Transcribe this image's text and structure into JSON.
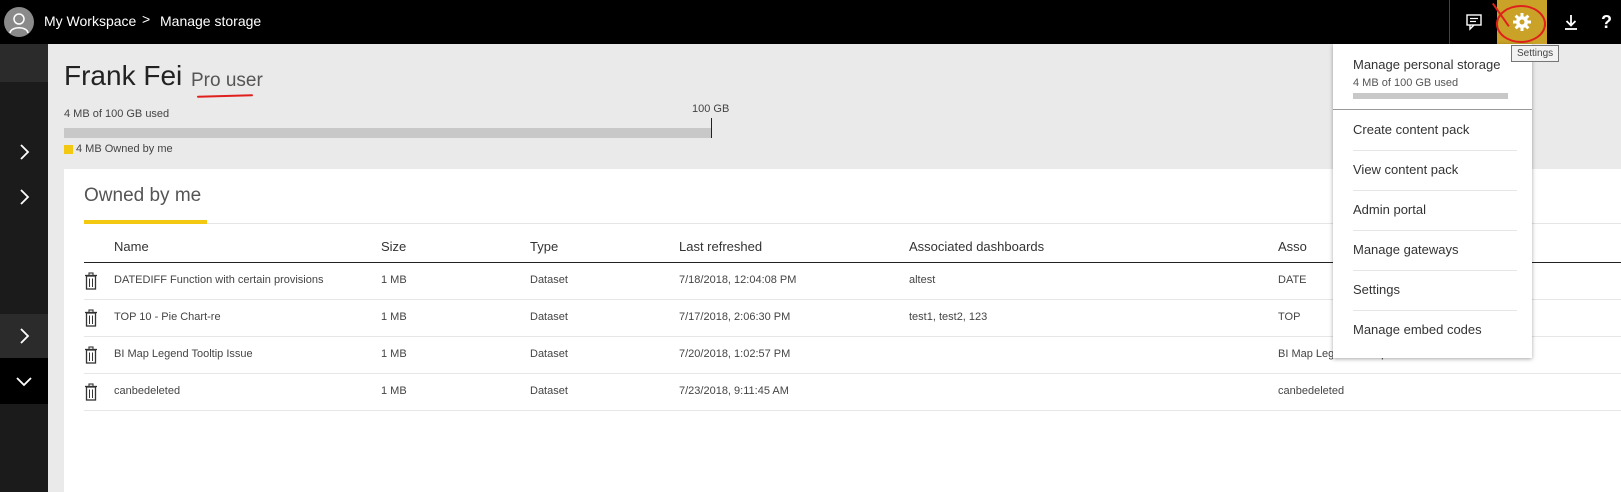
{
  "breadcrumb": {
    "workspace": "My Workspace",
    "separator": ">",
    "current": "Manage storage"
  },
  "topbar": {
    "icons": [
      "feedback-icon",
      "gear-icon",
      "download-icon",
      "help-icon"
    ],
    "help_glyph": "?",
    "settings_tooltip": "Settings",
    "settings_bg": "#c9a227"
  },
  "user": {
    "name": "Frank Fei",
    "role": "Pro user"
  },
  "storage": {
    "used_label": "4 MB of 100 GB used",
    "capacity_label": "100 GB",
    "used_fraction": 0,
    "legend_label": "4 MB Owned by me",
    "legend_color": "#f2c811"
  },
  "section": {
    "title": "Owned by me"
  },
  "table": {
    "columns": [
      "Name",
      "Size",
      "Type",
      "Last refreshed",
      "Associated dashboards",
      "Asso"
    ],
    "rows": [
      {
        "name": "DATEDIFF Function with certain provisions",
        "size": "1 MB",
        "type": "Dataset",
        "refreshed": "7/18/2018, 12:04:08 PM",
        "dashboards": "altest",
        "assoc": "DATE"
      },
      {
        "name": "TOP 10 - Pie Chart-re",
        "size": "1 MB",
        "type": "Dataset",
        "refreshed": "7/17/2018, 2:06:30 PM",
        "dashboards": "test1, test2, 123",
        "assoc": "TOP"
      },
      {
        "name": "BI Map Legend Tooltip Issue",
        "size": "1 MB",
        "type": "Dataset",
        "refreshed": "7/20/2018, 1:02:57 PM",
        "dashboards": "",
        "assoc": "BI Map Legend Tooltip Issue"
      },
      {
        "name": "canbedeleted",
        "size": "1 MB",
        "type": "Dataset",
        "refreshed": "7/23/2018, 9:11:45 AM",
        "dashboards": "",
        "assoc": "canbedeleted"
      }
    ]
  },
  "settings_menu": {
    "storage_title": "Manage personal storage",
    "storage_usage": "4 MB of 100 GB used",
    "items": [
      "Create content pack",
      "View content pack",
      "Admin portal",
      "Manage gateways",
      "Settings",
      "Manage embed codes"
    ]
  },
  "colors": {
    "accent_yellow": "#f2c811",
    "annotation_red": "#e0201d"
  }
}
